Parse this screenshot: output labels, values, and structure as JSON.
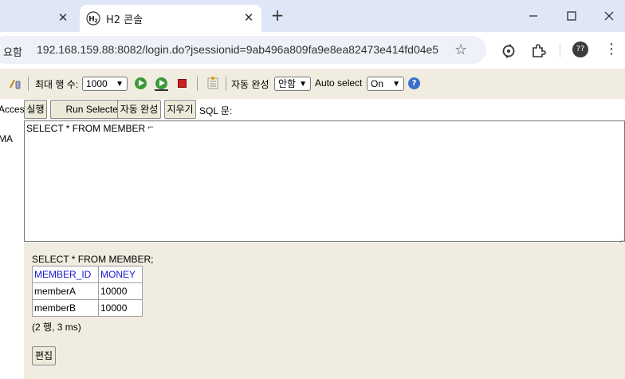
{
  "browser": {
    "inactive_tab": {
      "close_label": "✕"
    },
    "active_tab": {
      "title": "H2 콘솔",
      "close_label": "✕"
    },
    "new_tab_label": "+",
    "address": {
      "secure_label": "요함",
      "url": "192.168.159.88:8082/login.do?jsessionid=9ab496a809fa9e8ea82473e414fd04e5"
    },
    "profile_label": "??"
  },
  "toolbar": {
    "max_rows_label": "최대 행 수:",
    "max_rows_value": "1000",
    "autocomplete_label": "자동 완성",
    "autocomplete_value": "안함",
    "auto_select_label": "Auto select",
    "auto_select_value": "On"
  },
  "left_panel": {
    "line1": "Acces",
    "line2": "MA"
  },
  "query_buttons": {
    "run": "실행",
    "run_selected": "Run Selected",
    "auto_complete": "자동 완성",
    "clear": "지우기",
    "sql_label": "SQL 문:"
  },
  "editor": {
    "sql": "SELECT * FROM MEMBER"
  },
  "result": {
    "query": "SELECT * FROM MEMBER;",
    "columns": [
      "MEMBER_ID",
      "MONEY"
    ],
    "rows": [
      [
        "memberA",
        "10000"
      ],
      [
        "memberB",
        "10000"
      ]
    ],
    "summary": "(2 행, 3 ms)",
    "edit_label": "편집"
  },
  "colors": {
    "titlebar": "#dfe6f5",
    "panel": "#f0ede0",
    "header_link": "#1a1ad4",
    "run_green": "#3a9a3a",
    "stop_red": "#cc2222"
  }
}
